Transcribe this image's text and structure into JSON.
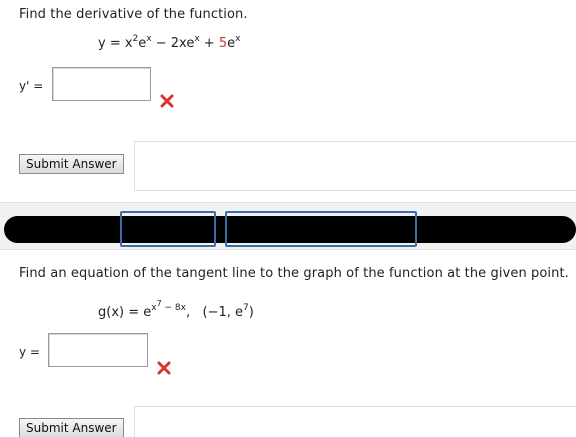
{
  "q1": {
    "prompt": "Find the derivative of the function.",
    "answer_label": "y' =",
    "answer_value": "",
    "result": "incorrect",
    "submit_label": "Submit Answer"
  },
  "q2": {
    "prompt": "Find an equation of the tangent line to the graph of the function at the given point.",
    "answer_label": "y =",
    "answer_value": "",
    "result": "incorrect",
    "submit_label": "Submit Answer"
  },
  "colors": {
    "incorrect_mark": "#d9342b",
    "frame_blue": "#3b6ea8",
    "math_red": "#c0392b"
  }
}
